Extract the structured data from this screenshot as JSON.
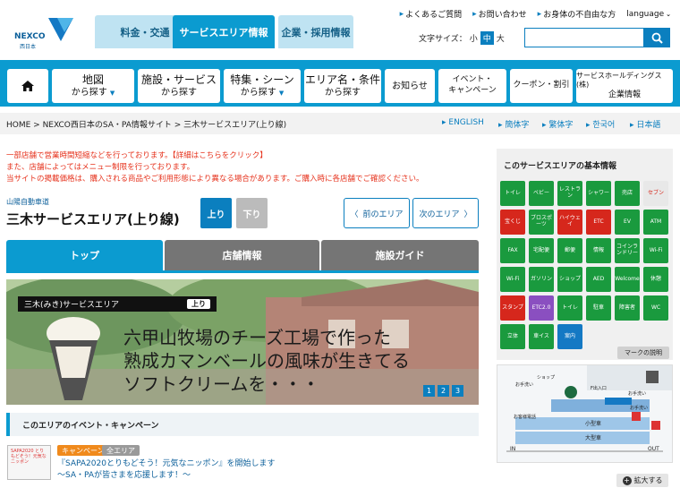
{
  "header": {
    "logo_text": "NEXCO",
    "logo_sub": "西日本",
    "tabs": [
      "料金・交通",
      "サービスエリア情報",
      "企業・採用情報"
    ],
    "links": [
      "よくあるご質問",
      "お問い合わせ",
      "お身体の不自由な方"
    ],
    "language": "language",
    "fontsize_label": "文字サイズ：",
    "fontsize_options": [
      "小",
      "中",
      "大"
    ],
    "search_placeholder": ""
  },
  "nav": [
    {
      "top": "地図",
      "bottom": "から探す",
      "dropdown": true
    },
    {
      "top": "施設・サービス",
      "bottom": "から探す",
      "dropdown": false
    },
    {
      "top": "特集・シーン",
      "bottom": "から探す",
      "dropdown": true
    },
    {
      "top": "エリア名・条件",
      "bottom": "から探す",
      "dropdown": false
    },
    {
      "top": "お知らせ",
      "bottom": "",
      "dropdown": false
    },
    {
      "top": "イベント・",
      "bottom": "キャンペーン",
      "dropdown": false
    },
    {
      "top": "クーポン・割引",
      "bottom": "",
      "dropdown": false
    },
    {
      "top": "サービスホールディングス(株)",
      "bottom": "企業情報",
      "dropdown": false
    }
  ],
  "breadcrumb": "HOME > NEXCO西日本のSA・PA情報サイト > 三木サービスエリア(上り線)",
  "languages": [
    "ENGLISH",
    "簡体字",
    "繁体字",
    "한국어",
    "日本語"
  ],
  "notice": [
    "一部店舗で営業時間短縮などを行っております。【詳細はこちらをクリック】",
    "また、店舗によってはメニュー制限を行っております。",
    "当サイトの掲載価格は、購入される商品やご利用形態により異なる場合があります。ご購入時に各店舗でご確認ください。"
  ],
  "road": "山陽自動車道",
  "sa_name": "三木サービスエリア(上り線)",
  "direction": {
    "up": "上り",
    "down": "下り"
  },
  "area_nav": {
    "prev": "前のエリア",
    "next": "次のエリア"
  },
  "page_tabs": [
    "トップ",
    "店舗情報",
    "施設ガイド"
  ],
  "hero": {
    "label": "三木(みき)サービスエリア",
    "label_badge": "上り",
    "text": [
      "六甲山牧場のチーズ工場で作った",
      "熟成カマンベールの風味が生きてる",
      "ソフトクリームを・・・"
    ],
    "dots": [
      "1",
      "2",
      "3"
    ]
  },
  "events": {
    "heading": "このエリアのイベント・キャンペーン",
    "badges": [
      "キャンペーン",
      "全エリア"
    ],
    "title": [
      "『SAPA2020とりもどそう！元気なニッポン』を開始します",
      "～SA・PAが皆さまを応援します！～"
    ],
    "thumb_text": "SAPA2020 とりもどそう！元気なニッポン"
  },
  "sidebar": {
    "title": "このサービスエリアの基本情報",
    "icons": [
      "トイレ",
      "ベビー",
      "レストラン",
      "シャワー",
      "売店",
      "セブン",
      "宝くじ",
      "ブロスポーツ",
      "ハイウェイ",
      "ETC",
      "EV",
      "ATM",
      "FAX",
      "宅配便",
      "郵便",
      "情報",
      "コインランドリー",
      "Wi-Fi",
      "Wi-Fi",
      "ガソリン",
      "ショップ",
      "AED",
      "Welcome",
      "休憩",
      "スタンプ",
      "ETC2.0",
      "トイレ",
      "駐車",
      "障害者",
      "WC",
      "立体",
      "車イス",
      "案内",
      "",
      "",
      ""
    ],
    "mark_button": "マークの説明",
    "map_labels": [
      "ショップ",
      "お手洗い",
      "F出入口",
      "お手洗い",
      "お客様電話",
      "お手洗い",
      "小型車",
      "大型車",
      "IN",
      "OUT"
    ],
    "zoom_button": "拡大する"
  },
  "colors": {
    "brand": "#0b9bd0",
    "brand_dark": "#0b7fbf",
    "green": "#1a9a3e",
    "red": "#e6321c"
  }
}
